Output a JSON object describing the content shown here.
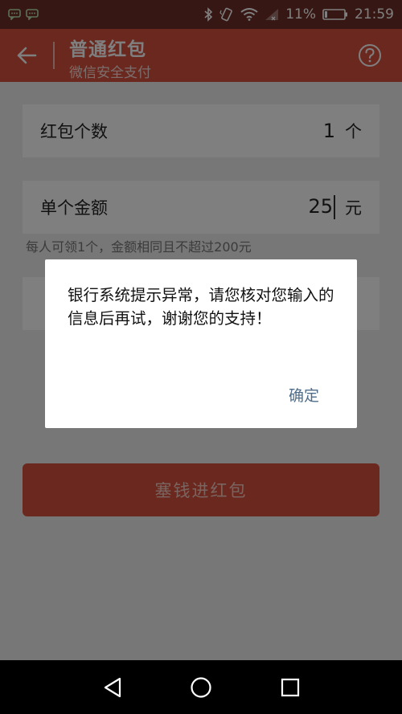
{
  "status_bar": {
    "battery": "11%",
    "time": "21:59",
    "left_icons": [
      "chat-notification-icon",
      "chat-notification-icon"
    ],
    "right_icons": [
      "bluetooth-icon",
      "vibrate-icon",
      "wifi-icon",
      "signal-icon",
      "battery-icon"
    ]
  },
  "header": {
    "title": "普通红包",
    "subtitle": "微信安全支付",
    "back_icon": "back-arrow-icon",
    "help_icon": "help-icon"
  },
  "form": {
    "count": {
      "label": "红包个数",
      "value": "1",
      "unit": "个"
    },
    "amount": {
      "label": "单个金额",
      "value": "25",
      "unit": "元"
    },
    "hint": "每人可领1个，金额相同且不超过200元",
    "submit_label": "塞钱进红包"
  },
  "dialog": {
    "message": "银行系统提示异常，请您核对您输入的信息后再试，谢谢您的支持！",
    "ok_label": "确定"
  },
  "colors": {
    "accent": "#d6513c",
    "status_bar": "#6e2e26",
    "dialog_button": "#4f6d8b"
  }
}
